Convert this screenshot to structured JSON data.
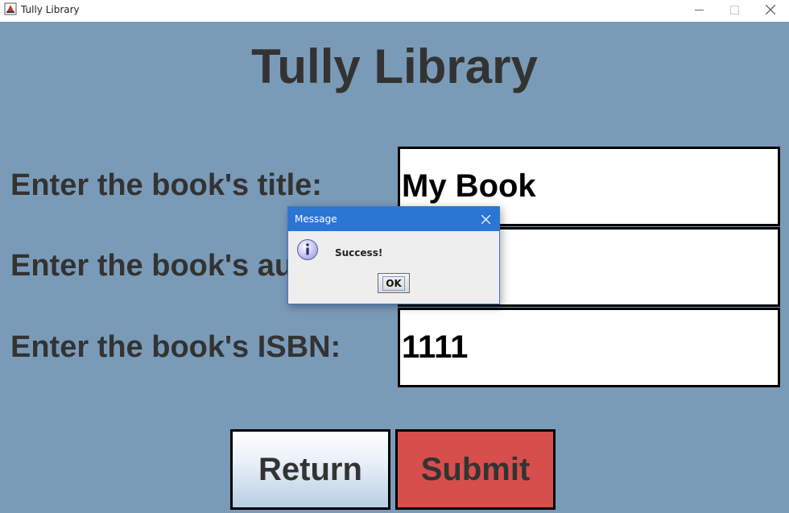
{
  "window": {
    "title": "Tully Library",
    "icons": {
      "app": "java-app-icon",
      "minimize": "minimize-icon",
      "maximize": "maximize-icon",
      "close": "close-icon"
    }
  },
  "heading": "Tully Library",
  "form": {
    "title_label": "Enter the book's title:",
    "title_value": "My Book",
    "author_label": "Enter the book's author:",
    "author_value": "",
    "isbn_label": "Enter the book's ISBN:",
    "isbn_value": "1111"
  },
  "buttons": {
    "return_label": "Return",
    "submit_label": "Submit"
  },
  "dialog": {
    "title": "Message",
    "message": "Success!",
    "ok_label": "OK",
    "icon": "info-icon"
  },
  "colors": {
    "background": "#7a9bb8",
    "heading_text": "#333333",
    "submit_bg": "#d64f4c",
    "dialog_header": "#2a76d2"
  }
}
